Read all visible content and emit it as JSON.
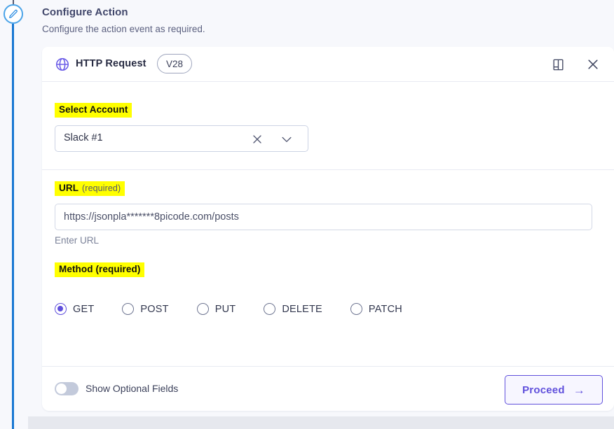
{
  "rail": {
    "node_icon": "pencil-icon"
  },
  "page": {
    "heading": "Configure Action",
    "subheading": "Configure the action event as required."
  },
  "card": {
    "header": {
      "app_icon": "globe-icon",
      "title": "HTTP Request",
      "version": "V28",
      "docs_icon": "book-icon",
      "close_icon": "close-icon"
    },
    "account_section": {
      "label": "Select Account",
      "label_highlight_color": "#ffff00",
      "selected_value": "Slack #1",
      "clear_icon": "clear-x-icon",
      "caret_icon": "chevron-down-icon"
    },
    "url_field": {
      "label": "URL",
      "required_text": "(required)",
      "value": "https://jsonpla*******8picode.com/posts",
      "placeholder": "Enter URL",
      "helper_text": "Enter URL"
    },
    "method_field": {
      "label": "Method (required)",
      "selected": "GET",
      "options": [
        {
          "label": "GET",
          "selected": true
        },
        {
          "label": "POST",
          "selected": false
        },
        {
          "label": "PUT",
          "selected": false
        },
        {
          "label": "DELETE",
          "selected": false
        },
        {
          "label": "PATCH",
          "selected": false
        }
      ]
    },
    "footer": {
      "toggle_label": "Show Optional Fields",
      "toggle_on": false,
      "proceed_label": "Proceed",
      "proceed_arrow": "→"
    }
  },
  "colors": {
    "accent_purple": "#6050dc",
    "rail_blue": "#1877d2",
    "highlight_yellow": "#ffff00",
    "page_bg": "#f7f8fc"
  }
}
